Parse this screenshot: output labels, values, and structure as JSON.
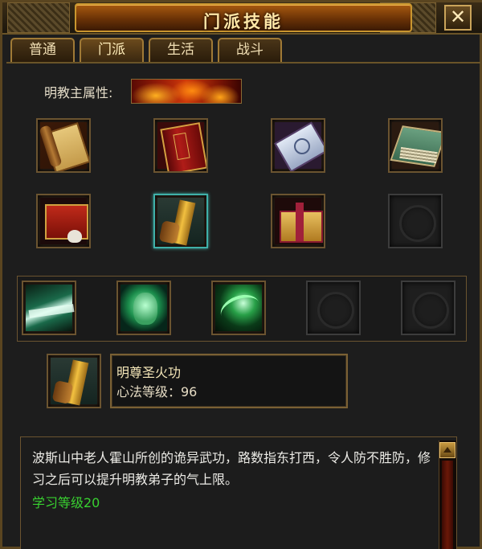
{
  "window": {
    "title": "门派技能",
    "close_label": "✕"
  },
  "tabs": [
    {
      "label": "普通"
    },
    {
      "label": "门派"
    },
    {
      "label": "生活"
    },
    {
      "label": "战斗"
    }
  ],
  "attribute": {
    "label": "明教主属性:"
  },
  "skill_grid": {
    "row1": [
      "scroll-icon",
      "red-book-icon",
      "blue-scroll-icon",
      "green-book-icon"
    ],
    "row2": [
      "red-scroll-skull-icon",
      "gold-tablet-icon",
      "gift-box-icon",
      "empty-slot-icon"
    ],
    "row3": [
      "green-blade-icon",
      "green-face-icon",
      "green-swirl-icon",
      "empty-slot-icon",
      "empty-slot-icon"
    ]
  },
  "selected_skill": {
    "name": "明尊圣火功",
    "level_text": "心法等级：96",
    "icon": "gold-tablet-icon"
  },
  "description": {
    "text": "波斯山中老人霍山所创的诡异武功，路数指东打西，令人防不胜防，修习之后可以提升明教弟子的气上限。",
    "requirement": "学习等级20"
  },
  "colors": {
    "requirement_green": "#38d030",
    "selected_border": "#3fb0a8"
  }
}
